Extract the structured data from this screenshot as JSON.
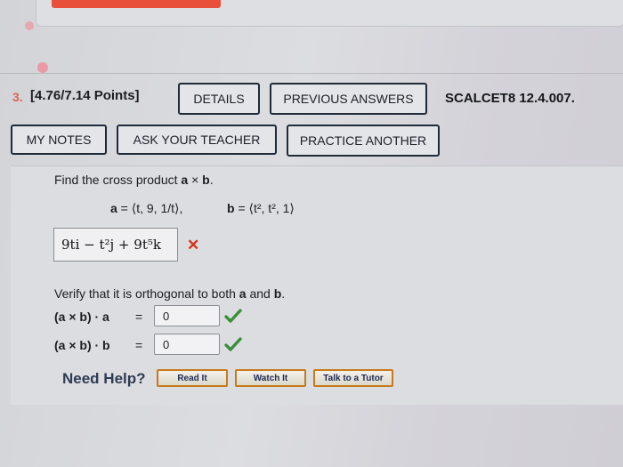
{
  "question": {
    "number": "3.",
    "points": "[4.76/7.14 Points]",
    "details_label": "DETAILS",
    "previous_answers_label": "PREVIOUS ANSWERS",
    "reference": "SCALCET8 12.4.007.",
    "my_notes_label": "MY NOTES",
    "ask_teacher_label": "ASK YOUR TEACHER",
    "practice_label": "PRACTICE ANOTHER"
  },
  "problem": {
    "prompt_pre": "Find the cross product ",
    "prompt_a": "a",
    "prompt_times": " × ",
    "prompt_b": "b",
    "prompt_end": ".",
    "vector_a_label": "a",
    "vector_a_value": " = ⟨t, 9, 1/t⟩,",
    "vector_b_label": "b",
    "vector_b_value": " = ⟨t², t², 1⟩",
    "answer": "9ti − t²j + 9t⁵k",
    "answer_status": "incorrect",
    "verify_pre": "Verify that it is orthogonal to both ",
    "verify_a": "a",
    "verify_mid": " and ",
    "verify_b": "b",
    "verify_end": ".",
    "dot_a_label": "(a × b) · a",
    "dot_a_eq": "=",
    "dot_a_value": "0",
    "dot_a_status": "correct",
    "dot_b_label": "(a × b) · b",
    "dot_b_eq": "=",
    "dot_b_value": "0",
    "dot_b_status": "correct"
  },
  "help": {
    "title": "Need Help?",
    "read_it": "Read It",
    "watch_it": "Watch It",
    "tutor": "Talk to a Tutor"
  },
  "colors": {
    "accent": "#e8503b",
    "correct": "#3a8f3a",
    "incorrect": "#d7311d",
    "help_border": "#c87a1a"
  }
}
